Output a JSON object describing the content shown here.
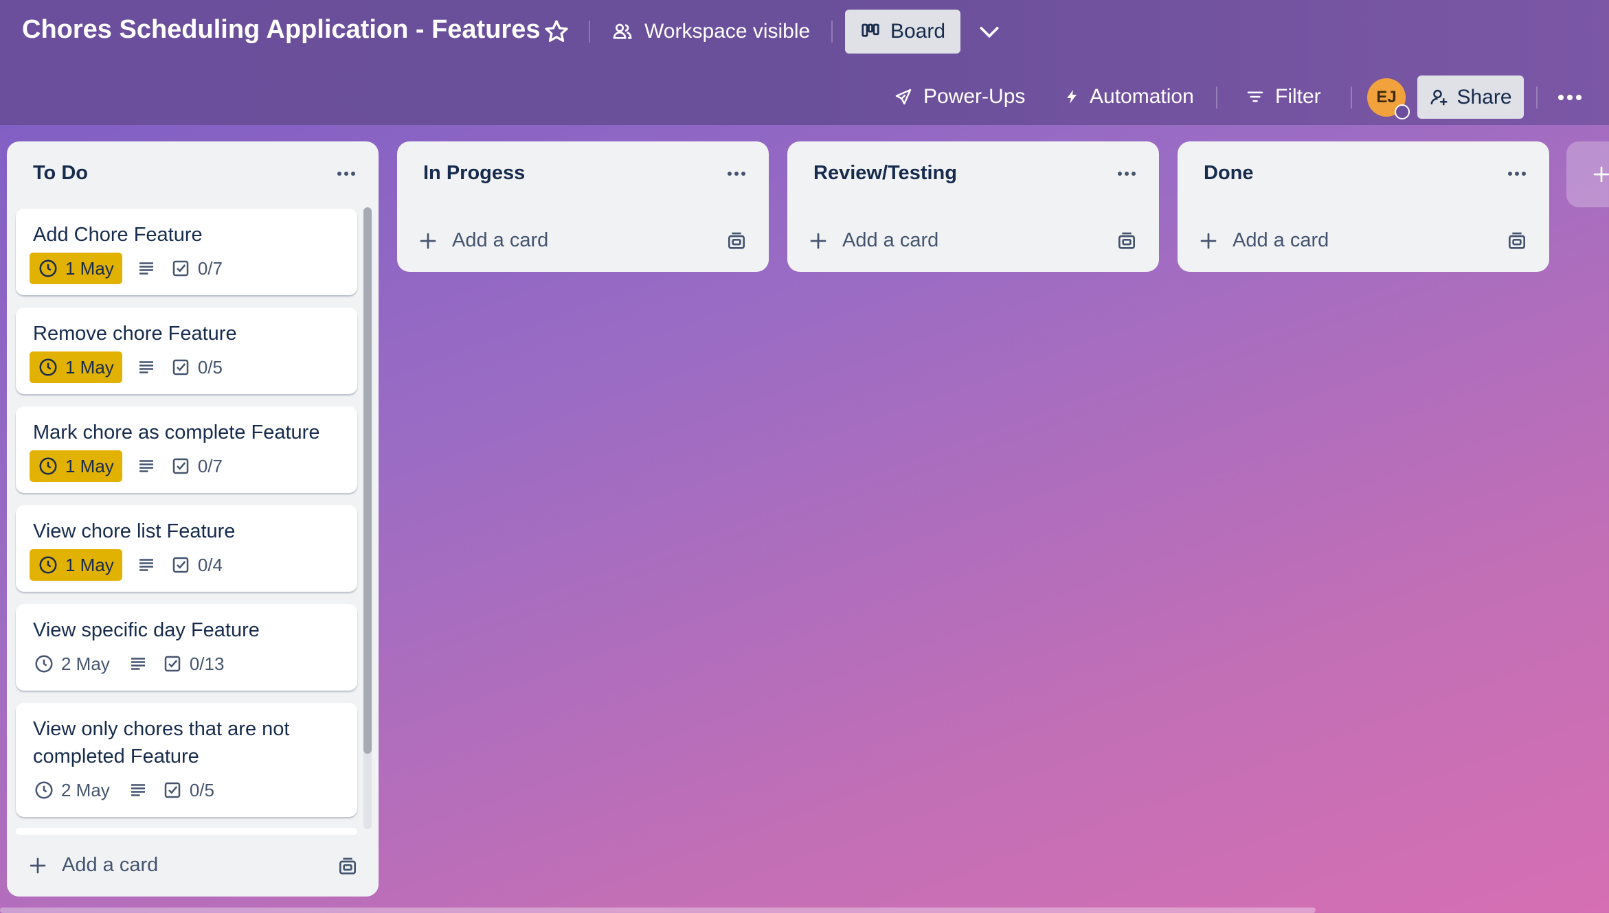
{
  "header": {
    "board_title": "Chores Scheduling Application - Features",
    "visibility_label": "Workspace visible",
    "view_label": "Board",
    "power_ups_label": "Power-Ups",
    "automation_label": "Automation",
    "filter_label": "Filter",
    "avatar_initials": "EJ",
    "share_label": "Share"
  },
  "lists": [
    {
      "title": "To Do",
      "add_card_label": "Add a card",
      "cards": [
        {
          "title": "Add Chore Feature",
          "due": "1 May",
          "due_status": "due-soon",
          "checklist": "0/7"
        },
        {
          "title": "Remove chore Feature",
          "due": "1 May",
          "due_status": "due-soon",
          "checklist": "0/5"
        },
        {
          "title": "Mark chore as complete Feature",
          "due": "1 May",
          "due_status": "due-soon",
          "checklist": "0/7"
        },
        {
          "title": "View chore list Feature",
          "due": "1 May",
          "due_status": "due-soon",
          "checklist": "0/4"
        },
        {
          "title": "View specific day Feature",
          "due": "2 May",
          "due_status": "normal",
          "checklist": "0/13"
        },
        {
          "title": "View only chores that are not completed Feature",
          "due": "2 May",
          "due_status": "normal",
          "checklist": "0/5"
        }
      ]
    },
    {
      "title": "In Progess",
      "add_card_label": "Add a card",
      "cards": []
    },
    {
      "title": "Review/Testing",
      "add_card_label": "Add a card",
      "cards": []
    },
    {
      "title": "Done",
      "add_card_label": "Add a card",
      "cards": []
    }
  ],
  "colors": {
    "due_soon": "#e2b203",
    "list_bg": "#f1f2f4",
    "header_bg": "#6b4f9c",
    "avatar_bg": "#f2a23c"
  }
}
